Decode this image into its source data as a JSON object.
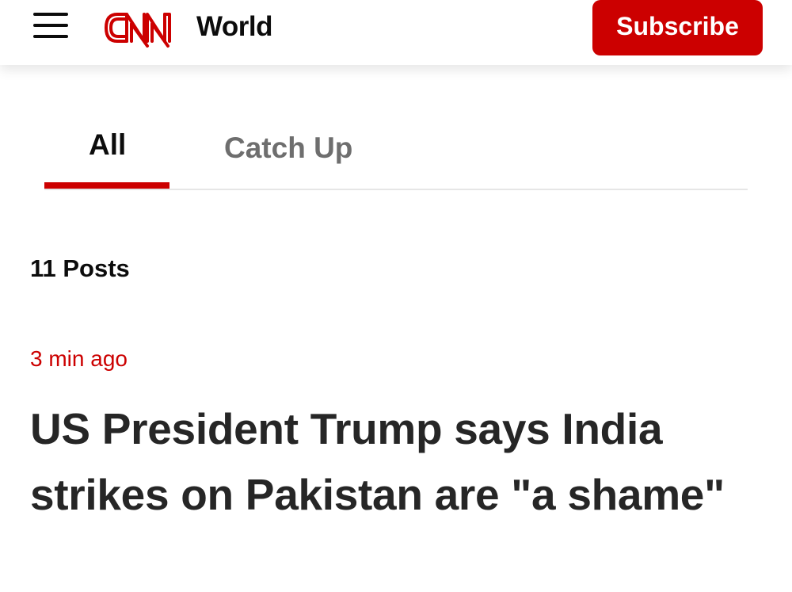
{
  "header": {
    "logo_text": "CNN",
    "section": "World",
    "subscribe_label": "Subscribe",
    "brand_color": "#cc0000"
  },
  "tabs": [
    {
      "label": "All",
      "active": true
    },
    {
      "label": "Catch Up",
      "active": false
    }
  ],
  "feed": {
    "post_count": "11 Posts",
    "posts": [
      {
        "timestamp": "3 min ago",
        "headline": "US President Trump says India strikes on Pakistan are \"a shame\""
      }
    ]
  },
  "icons": [
    "hamburger-menu-icon",
    "cnn-logo"
  ]
}
